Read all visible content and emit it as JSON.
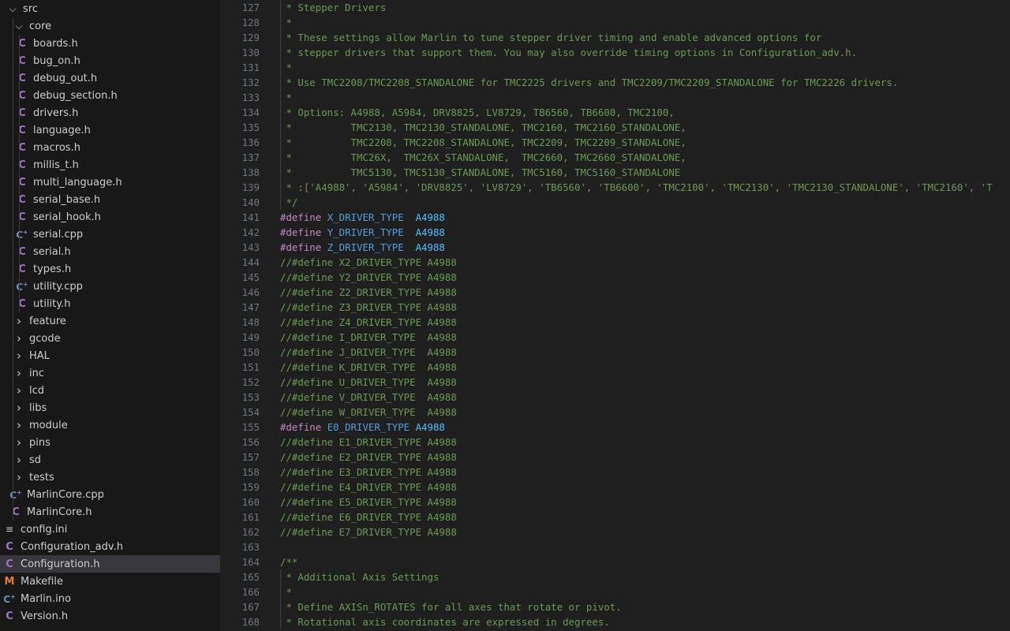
{
  "explorer": {
    "items": [
      {
        "label": "src",
        "kind": "folder-open",
        "depth": 0
      },
      {
        "label": "core",
        "kind": "folder-open",
        "depth": 1
      },
      {
        "label": "boards.h",
        "kind": "h",
        "depth": 2
      },
      {
        "label": "bug_on.h",
        "kind": "h",
        "depth": 2
      },
      {
        "label": "debug_out.h",
        "kind": "h",
        "depth": 2
      },
      {
        "label": "debug_section.h",
        "kind": "h",
        "depth": 2
      },
      {
        "label": "drivers.h",
        "kind": "h",
        "depth": 2
      },
      {
        "label": "language.h",
        "kind": "h",
        "depth": 2
      },
      {
        "label": "macros.h",
        "kind": "h",
        "depth": 2
      },
      {
        "label": "millis_t.h",
        "kind": "h",
        "depth": 2
      },
      {
        "label": "multi_language.h",
        "kind": "h",
        "depth": 2
      },
      {
        "label": "serial_base.h",
        "kind": "h",
        "depth": 2
      },
      {
        "label": "serial_hook.h",
        "kind": "h",
        "depth": 2
      },
      {
        "label": "serial.cpp",
        "kind": "cpp",
        "depth": 2
      },
      {
        "label": "serial.h",
        "kind": "h",
        "depth": 2
      },
      {
        "label": "types.h",
        "kind": "h",
        "depth": 2
      },
      {
        "label": "utility.cpp",
        "kind": "cpp",
        "depth": 2
      },
      {
        "label": "utility.h",
        "kind": "h",
        "depth": 2
      },
      {
        "label": "feature",
        "kind": "folder",
        "depth": 1
      },
      {
        "label": "gcode",
        "kind": "folder",
        "depth": 1
      },
      {
        "label": "HAL",
        "kind": "folder",
        "depth": 1
      },
      {
        "label": "inc",
        "kind": "folder",
        "depth": 1
      },
      {
        "label": "lcd",
        "kind": "folder",
        "depth": 1
      },
      {
        "label": "libs",
        "kind": "folder",
        "depth": 1
      },
      {
        "label": "module",
        "kind": "folder",
        "depth": 1
      },
      {
        "label": "pins",
        "kind": "folder",
        "depth": 1
      },
      {
        "label": "sd",
        "kind": "folder",
        "depth": 1
      },
      {
        "label": "tests",
        "kind": "folder",
        "depth": 1
      },
      {
        "label": "MarlinCore.cpp",
        "kind": "cpp",
        "depth": 1
      },
      {
        "label": "MarlinCore.h",
        "kind": "h",
        "depth": 1
      },
      {
        "label": "config.ini",
        "kind": "ini",
        "depth": 0
      },
      {
        "label": "Configuration_adv.h",
        "kind": "h",
        "depth": 0
      },
      {
        "label": "Configuration.h",
        "kind": "h",
        "depth": 0,
        "selected": true
      },
      {
        "label": "Makefile",
        "kind": "make",
        "depth": 0
      },
      {
        "label": "Marlin.ino",
        "kind": "cpp",
        "depth": 0
      },
      {
        "label": "Version.h",
        "kind": "h",
        "depth": 0
      }
    ],
    "icon_glyphs": {
      "h": "C",
      "cpp": "C",
      "ini": "≡",
      "make": "M"
    },
    "colors": {
      "h": "#a074c4",
      "cpp": "#6c8ebf",
      "make": "#e37933",
      "selected_bg": "#37373d"
    }
  },
  "editor": {
    "lines": [
      {
        "n": "127",
        "t": "c",
        "text": " * Stepper Drivers"
      },
      {
        "n": "128",
        "t": "c",
        "text": " *"
      },
      {
        "n": "129",
        "t": "c",
        "text": " * These settings allow Marlin to tune stepper driver timing and enable advanced options for"
      },
      {
        "n": "130",
        "t": "c",
        "text": " * stepper drivers that support them. You may also override timing options in Configuration_adv.h."
      },
      {
        "n": "131",
        "t": "c",
        "text": " *"
      },
      {
        "n": "132",
        "t": "c",
        "text": " * Use TMC2208/TMC2208_STANDALONE for TMC2225 drivers and TMC2209/TMC2209_STANDALONE for TMC2226 drivers."
      },
      {
        "n": "133",
        "t": "c",
        "text": " *"
      },
      {
        "n": "134",
        "t": "c",
        "text": " * Options: A4988, A5984, DRV8825, LV8729, TB6560, TB6600, TMC2100,"
      },
      {
        "n": "135",
        "t": "c",
        "text": " *          TMC2130, TMC2130_STANDALONE, TMC2160, TMC2160_STANDALONE,"
      },
      {
        "n": "136",
        "t": "c",
        "text": " *          TMC2208, TMC2208_STANDALONE, TMC2209, TMC2209_STANDALONE,"
      },
      {
        "n": "137",
        "t": "c",
        "text": " *          TMC26X,  TMC26X_STANDALONE,  TMC2660, TMC2660_STANDALONE,"
      },
      {
        "n": "138",
        "t": "c",
        "text": " *          TMC5130, TMC5130_STANDALONE, TMC5160, TMC5160_STANDALONE"
      },
      {
        "n": "139",
        "t": "c",
        "text": " * :['A4988', 'A5984', 'DRV8825', 'LV8729', 'TB6560', 'TB6600', 'TMC2100', 'TMC2130', 'TMC2130_STANDALONE', 'TMC2160', 'T"
      },
      {
        "n": "140",
        "t": "c",
        "text": " */"
      },
      {
        "n": "141",
        "t": "d",
        "kw": "#define",
        "name": "X_DRIVER_TYPE",
        "pad": "  ",
        "value": "A4988"
      },
      {
        "n": "142",
        "t": "d",
        "kw": "#define",
        "name": "Y_DRIVER_TYPE",
        "pad": "  ",
        "value": "A4988"
      },
      {
        "n": "143",
        "t": "d",
        "kw": "#define",
        "name": "Z_DRIVER_TYPE",
        "pad": "  ",
        "value": "A4988"
      },
      {
        "n": "144",
        "t": "c",
        "text": "//#define X2_DRIVER_TYPE A4988"
      },
      {
        "n": "145",
        "t": "c",
        "text": "//#define Y2_DRIVER_TYPE A4988"
      },
      {
        "n": "146",
        "t": "c",
        "text": "//#define Z2_DRIVER_TYPE A4988"
      },
      {
        "n": "147",
        "t": "c",
        "text": "//#define Z3_DRIVER_TYPE A4988"
      },
      {
        "n": "148",
        "t": "c",
        "text": "//#define Z4_DRIVER_TYPE A4988"
      },
      {
        "n": "149",
        "t": "c",
        "text": "//#define I_DRIVER_TYPE  A4988"
      },
      {
        "n": "150",
        "t": "c",
        "text": "//#define J_DRIVER_TYPE  A4988"
      },
      {
        "n": "151",
        "t": "c",
        "text": "//#define K_DRIVER_TYPE  A4988"
      },
      {
        "n": "152",
        "t": "c",
        "text": "//#define U_DRIVER_TYPE  A4988"
      },
      {
        "n": "153",
        "t": "c",
        "text": "//#define V_DRIVER_TYPE  A4988"
      },
      {
        "n": "154",
        "t": "c",
        "text": "//#define W_DRIVER_TYPE  A4988"
      },
      {
        "n": "155",
        "t": "d",
        "kw": "#define",
        "name": "E0_DRIVER_TYPE",
        "pad": " ",
        "value": "A4988"
      },
      {
        "n": "156",
        "t": "c",
        "text": "//#define E1_DRIVER_TYPE A4988"
      },
      {
        "n": "157",
        "t": "c",
        "text": "//#define E2_DRIVER_TYPE A4988"
      },
      {
        "n": "158",
        "t": "c",
        "text": "//#define E3_DRIVER_TYPE A4988"
      },
      {
        "n": "159",
        "t": "c",
        "text": "//#define E4_DRIVER_TYPE A4988"
      },
      {
        "n": "160",
        "t": "c",
        "text": "//#define E5_DRIVER_TYPE A4988"
      },
      {
        "n": "161",
        "t": "c",
        "text": "//#define E6_DRIVER_TYPE A4988"
      },
      {
        "n": "162",
        "t": "c",
        "text": "//#define E7_DRIVER_TYPE A4988"
      },
      {
        "n": "163",
        "t": "c",
        "text": ""
      },
      {
        "n": "164",
        "t": "c",
        "text": "/**"
      },
      {
        "n": "165",
        "t": "c",
        "text": " * Additional Axis Settings"
      },
      {
        "n": "166",
        "t": "c",
        "text": " *"
      },
      {
        "n": "167",
        "t": "c",
        "text": " * Define AXISn_ROTATES for all axes that rotate or pivot."
      },
      {
        "n": "168",
        "t": "c",
        "text": " * Rotational axis coordinates are expressed in degrees."
      }
    ]
  }
}
